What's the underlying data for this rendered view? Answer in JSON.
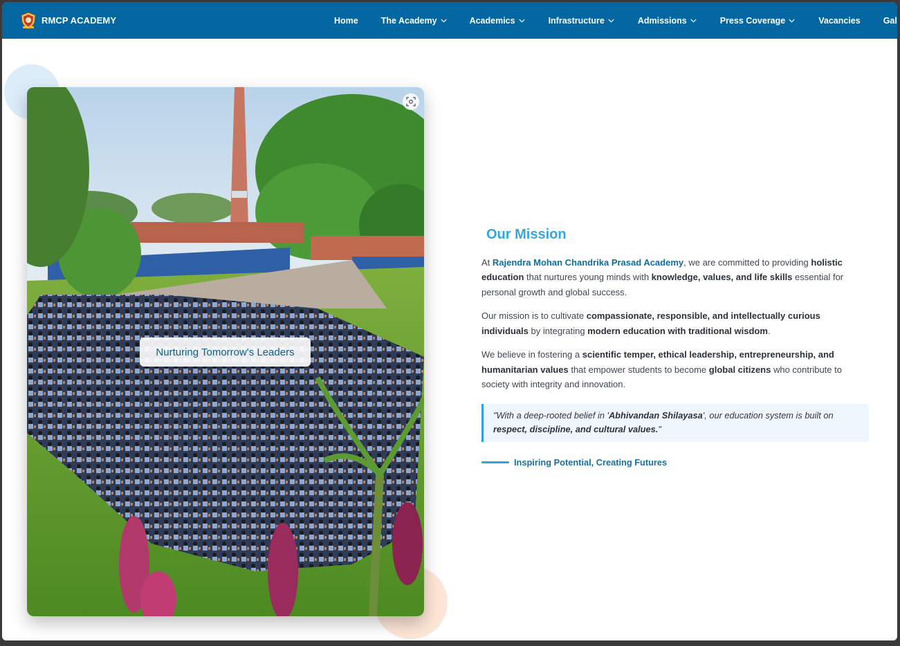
{
  "brand": {
    "name": "RMCP ACADEMY"
  },
  "nav": {
    "items": [
      {
        "label": "Home",
        "dropdown": false
      },
      {
        "label": "The Academy",
        "dropdown": true
      },
      {
        "label": "Academics",
        "dropdown": true
      },
      {
        "label": "Infrastructure",
        "dropdown": true
      },
      {
        "label": "Admissions",
        "dropdown": true
      },
      {
        "label": "Press Coverage",
        "dropdown": true
      },
      {
        "label": "Vacancies",
        "dropdown": false
      },
      {
        "label": "Gallery",
        "dropdown": false
      }
    ]
  },
  "photo": {
    "caption": "Nurturing Tomorrow's Leaders",
    "zoom_icon": "zoom-scan-icon"
  },
  "mission": {
    "title": "Our Mission",
    "p1": {
      "t1": "At ",
      "academy": "Rajendra Mohan Chandrika Prasad Academy",
      "t2": ", we are committed to providing ",
      "b1": "holistic education",
      "t3": " that nurtures young minds with ",
      "b2": "knowledge, values, and life skills",
      "t4": " essential for personal growth and global success."
    },
    "p2": {
      "t1": "Our mission is to cultivate ",
      "b1": "compassionate, responsible, and intellectually curious individuals",
      "t2": " by integrating ",
      "b2": "modern education with traditional wisdom",
      "t3": "."
    },
    "p3": {
      "t1": "We believe in fostering a ",
      "b1": "scientific temper, ethical leadership, entrepreneurship, and humanitarian values",
      "t2": " that empower students to become ",
      "b2": "global citizens",
      "t3": " who contribute to society with integrity and innovation."
    },
    "quote": {
      "t1": "\"With a deep-rooted belief in '",
      "b1": "Abhivandan Shilayasa",
      "t2": "', our education system is built on ",
      "b2": "respect, discipline, and cultural values.",
      "t3": "\""
    },
    "tagline": "Inspiring Potential, Creating Futures"
  },
  "colors": {
    "navbar": "#0467a2",
    "accent": "#34a6de",
    "link": "#0b6ea3"
  }
}
